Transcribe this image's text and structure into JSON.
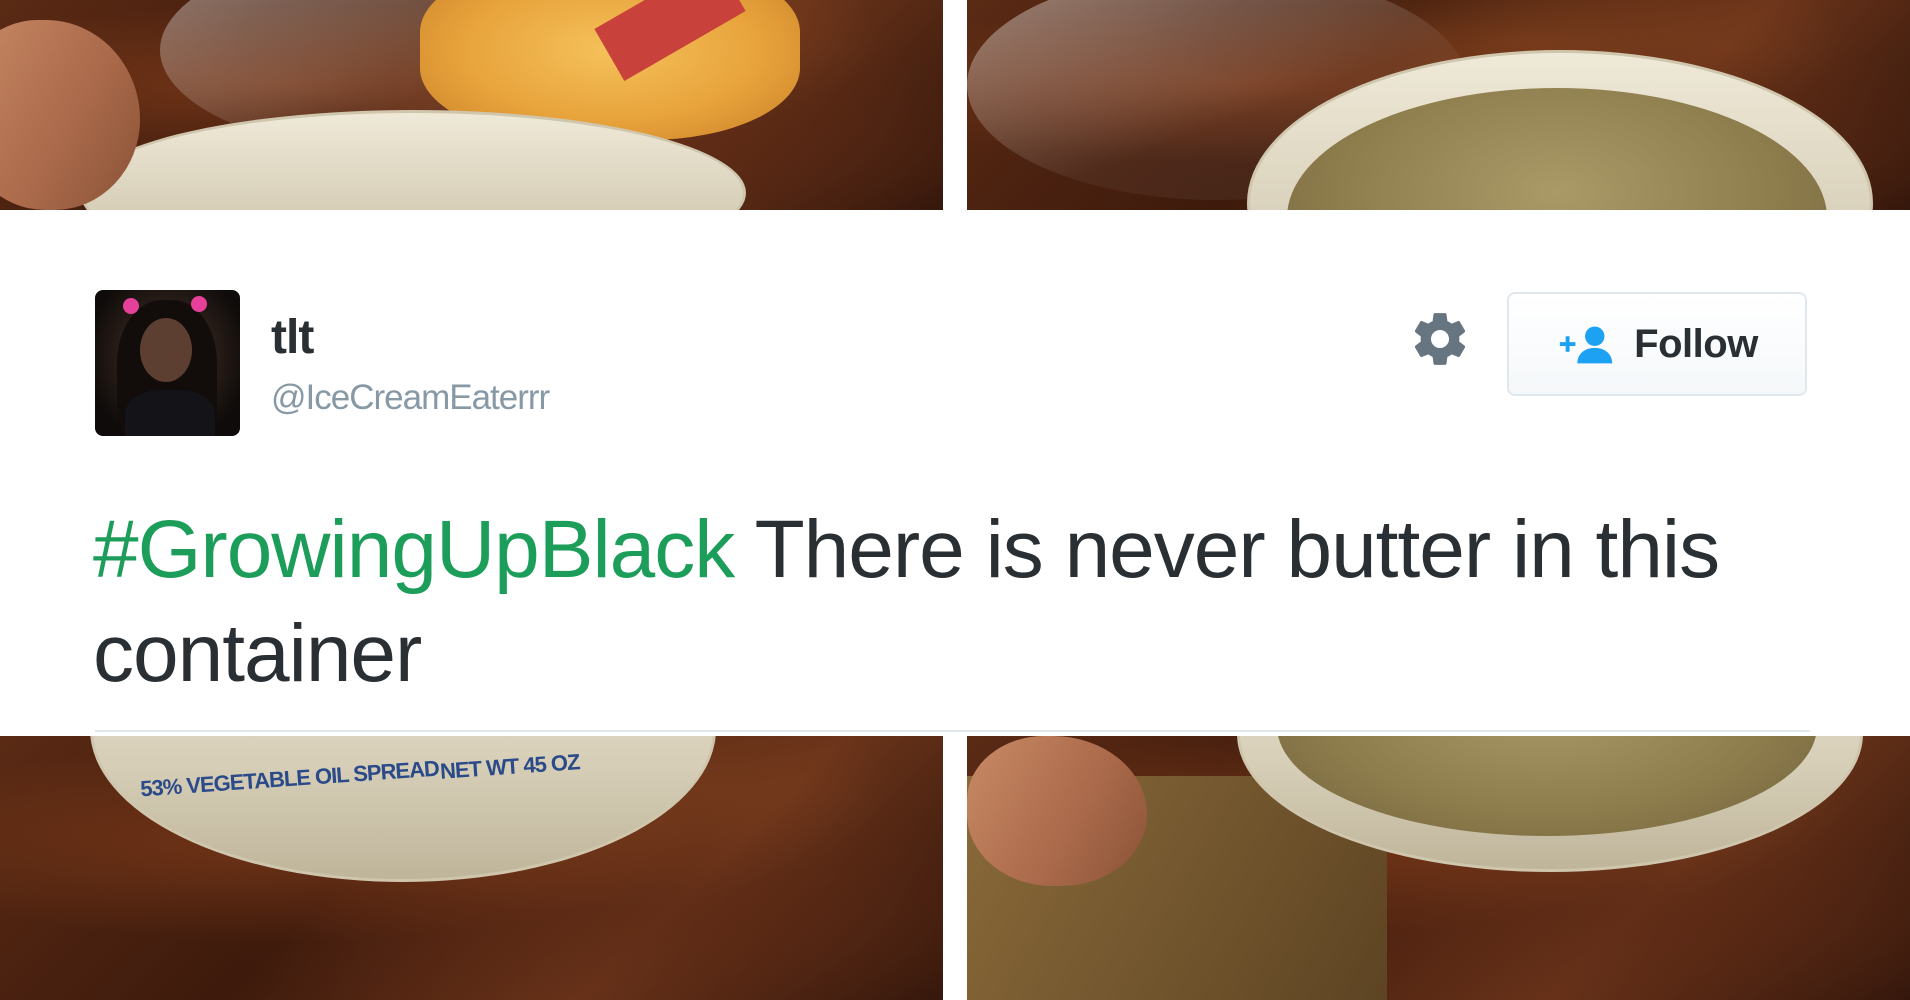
{
  "tweet": {
    "display_name": "tlt",
    "handle": "@IceCreamEaterrr",
    "hashtag": "#GrowingUpBlack",
    "text": " There is never butter in this container",
    "follow_label": "Follow"
  },
  "photos": {
    "tub_label_1": "53% VEGETABLE OIL SPREAD",
    "tub_label_2": "NET WT 45 OZ"
  },
  "icons": {
    "settings": "gear-icon",
    "follow": "add-user-icon"
  },
  "colors": {
    "hashtag": "#1c9e5a",
    "text": "#292f33",
    "handle": "#8899a6",
    "follow_icon": "#1da1f2"
  }
}
